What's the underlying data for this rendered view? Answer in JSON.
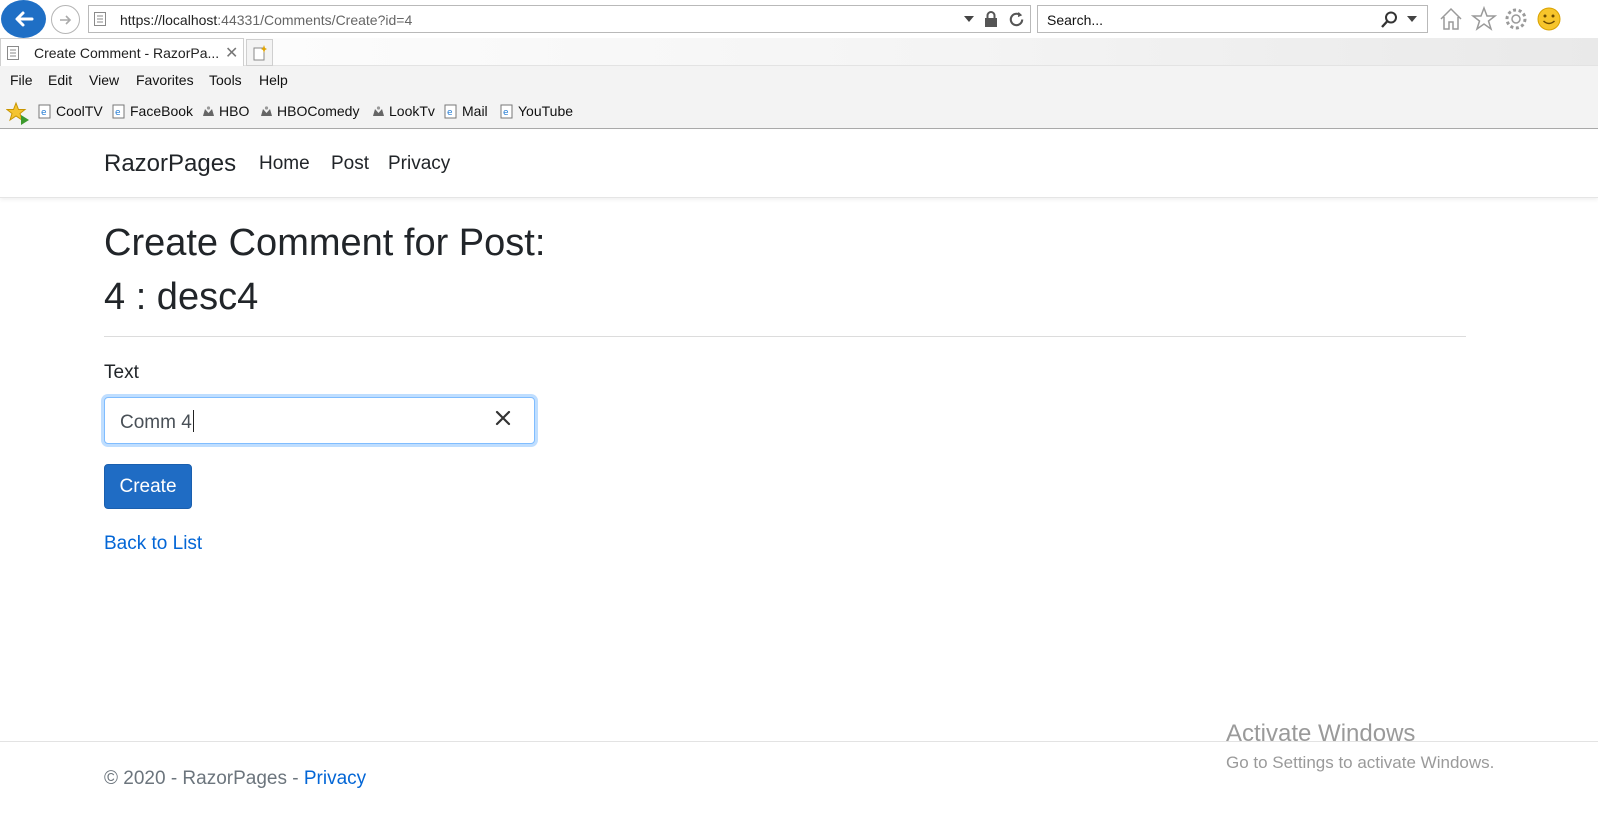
{
  "browser": {
    "url_prefix": "https://localhost",
    "url_rest": ":44331/Comments/Create?id=4",
    "search_placeholder": "Search...",
    "tab_title": "Create Comment - RazorPa...",
    "tab_close": "✕",
    "menu": [
      "File",
      "Edit",
      "View",
      "Favorites",
      "Tools",
      "Help"
    ],
    "favorites": [
      "CoolTV",
      "FaceBook",
      "HBO",
      "HBOComedy",
      "LookTv",
      "Mail",
      "YouTube"
    ]
  },
  "site": {
    "brand": "RazorPages",
    "nav": [
      "Home",
      "Post",
      "Privacy"
    ]
  },
  "page": {
    "heading_line1": "Create Comment for Post:",
    "heading_line2": "4 : desc4",
    "field_label": "Text",
    "field_value": "Comm 4",
    "submit_label": "Create",
    "back_link": "Back to List"
  },
  "footer": {
    "text": "© 2020 - RazorPages - ",
    "privacy": "Privacy"
  },
  "watermark": {
    "line1": "Activate Windows",
    "line2": "Go to Settings to activate Windows."
  },
  "colors": {
    "accent": "#1f6cc4",
    "link": "#0366d6",
    "focus_border": "#80bdff"
  }
}
